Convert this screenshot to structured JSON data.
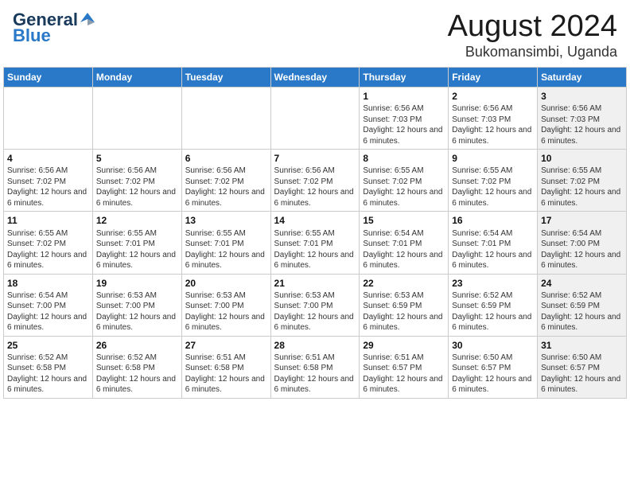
{
  "header": {
    "logo": {
      "general": "General",
      "blue": "Blue"
    },
    "title": "August 2024",
    "location": "Bukomansimbi, Uganda"
  },
  "days_of_week": [
    "Sunday",
    "Monday",
    "Tuesday",
    "Wednesday",
    "Thursday",
    "Friday",
    "Saturday"
  ],
  "weeks": [
    [
      {
        "day": "",
        "info": "",
        "shaded": false
      },
      {
        "day": "",
        "info": "",
        "shaded": false
      },
      {
        "day": "",
        "info": "",
        "shaded": false
      },
      {
        "day": "",
        "info": "",
        "shaded": false
      },
      {
        "day": "1",
        "info": "Sunrise: 6:56 AM\nSunset: 7:03 PM\nDaylight: 12 hours and 6 minutes.",
        "shaded": false
      },
      {
        "day": "2",
        "info": "Sunrise: 6:56 AM\nSunset: 7:03 PM\nDaylight: 12 hours and 6 minutes.",
        "shaded": false
      },
      {
        "day": "3",
        "info": "Sunrise: 6:56 AM\nSunset: 7:03 PM\nDaylight: 12 hours and 6 minutes.",
        "shaded": true
      }
    ],
    [
      {
        "day": "4",
        "info": "Sunrise: 6:56 AM\nSunset: 7:02 PM\nDaylight: 12 hours and 6 minutes.",
        "shaded": false
      },
      {
        "day": "5",
        "info": "Sunrise: 6:56 AM\nSunset: 7:02 PM\nDaylight: 12 hours and 6 minutes.",
        "shaded": false
      },
      {
        "day": "6",
        "info": "Sunrise: 6:56 AM\nSunset: 7:02 PM\nDaylight: 12 hours and 6 minutes.",
        "shaded": false
      },
      {
        "day": "7",
        "info": "Sunrise: 6:56 AM\nSunset: 7:02 PM\nDaylight: 12 hours and 6 minutes.",
        "shaded": false
      },
      {
        "day": "8",
        "info": "Sunrise: 6:55 AM\nSunset: 7:02 PM\nDaylight: 12 hours and 6 minutes.",
        "shaded": false
      },
      {
        "day": "9",
        "info": "Sunrise: 6:55 AM\nSunset: 7:02 PM\nDaylight: 12 hours and 6 minutes.",
        "shaded": false
      },
      {
        "day": "10",
        "info": "Sunrise: 6:55 AM\nSunset: 7:02 PM\nDaylight: 12 hours and 6 minutes.",
        "shaded": true
      }
    ],
    [
      {
        "day": "11",
        "info": "Sunrise: 6:55 AM\nSunset: 7:02 PM\nDaylight: 12 hours and 6 minutes.",
        "shaded": false
      },
      {
        "day": "12",
        "info": "Sunrise: 6:55 AM\nSunset: 7:01 PM\nDaylight: 12 hours and 6 minutes.",
        "shaded": false
      },
      {
        "day": "13",
        "info": "Sunrise: 6:55 AM\nSunset: 7:01 PM\nDaylight: 12 hours and 6 minutes.",
        "shaded": false
      },
      {
        "day": "14",
        "info": "Sunrise: 6:55 AM\nSunset: 7:01 PM\nDaylight: 12 hours and 6 minutes.",
        "shaded": false
      },
      {
        "day": "15",
        "info": "Sunrise: 6:54 AM\nSunset: 7:01 PM\nDaylight: 12 hours and 6 minutes.",
        "shaded": false
      },
      {
        "day": "16",
        "info": "Sunrise: 6:54 AM\nSunset: 7:01 PM\nDaylight: 12 hours and 6 minutes.",
        "shaded": false
      },
      {
        "day": "17",
        "info": "Sunrise: 6:54 AM\nSunset: 7:00 PM\nDaylight: 12 hours and 6 minutes.",
        "shaded": true
      }
    ],
    [
      {
        "day": "18",
        "info": "Sunrise: 6:54 AM\nSunset: 7:00 PM\nDaylight: 12 hours and 6 minutes.",
        "shaded": false
      },
      {
        "day": "19",
        "info": "Sunrise: 6:53 AM\nSunset: 7:00 PM\nDaylight: 12 hours and 6 minutes.",
        "shaded": false
      },
      {
        "day": "20",
        "info": "Sunrise: 6:53 AM\nSunset: 7:00 PM\nDaylight: 12 hours and 6 minutes.",
        "shaded": false
      },
      {
        "day": "21",
        "info": "Sunrise: 6:53 AM\nSunset: 7:00 PM\nDaylight: 12 hours and 6 minutes.",
        "shaded": false
      },
      {
        "day": "22",
        "info": "Sunrise: 6:53 AM\nSunset: 6:59 PM\nDaylight: 12 hours and 6 minutes.",
        "shaded": false
      },
      {
        "day": "23",
        "info": "Sunrise: 6:52 AM\nSunset: 6:59 PM\nDaylight: 12 hours and 6 minutes.",
        "shaded": false
      },
      {
        "day": "24",
        "info": "Sunrise: 6:52 AM\nSunset: 6:59 PM\nDaylight: 12 hours and 6 minutes.",
        "shaded": true
      }
    ],
    [
      {
        "day": "25",
        "info": "Sunrise: 6:52 AM\nSunset: 6:58 PM\nDaylight: 12 hours and 6 minutes.",
        "shaded": false
      },
      {
        "day": "26",
        "info": "Sunrise: 6:52 AM\nSunset: 6:58 PM\nDaylight: 12 hours and 6 minutes.",
        "shaded": false
      },
      {
        "day": "27",
        "info": "Sunrise: 6:51 AM\nSunset: 6:58 PM\nDaylight: 12 hours and 6 minutes.",
        "shaded": false
      },
      {
        "day": "28",
        "info": "Sunrise: 6:51 AM\nSunset: 6:58 PM\nDaylight: 12 hours and 6 minutes.",
        "shaded": false
      },
      {
        "day": "29",
        "info": "Sunrise: 6:51 AM\nSunset: 6:57 PM\nDaylight: 12 hours and 6 minutes.",
        "shaded": false
      },
      {
        "day": "30",
        "info": "Sunrise: 6:50 AM\nSunset: 6:57 PM\nDaylight: 12 hours and 6 minutes.",
        "shaded": false
      },
      {
        "day": "31",
        "info": "Sunrise: 6:50 AM\nSunset: 6:57 PM\nDaylight: 12 hours and 6 minutes.",
        "shaded": true
      }
    ]
  ]
}
